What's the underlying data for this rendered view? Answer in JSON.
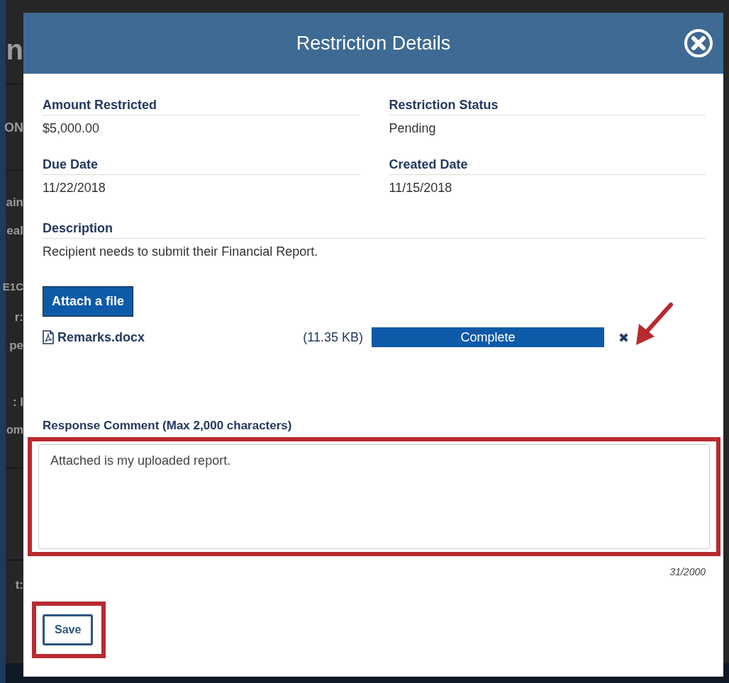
{
  "background": {
    "fragments": [
      "n",
      "ON",
      "ain",
      "eal",
      "E1C",
      "r:",
      "pe",
      ": I",
      "om",
      "t:"
    ]
  },
  "dialog": {
    "title": "Restriction Details",
    "fields": [
      {
        "label": "Amount Restricted",
        "value": "$5,000.00"
      },
      {
        "label": "Restriction Status",
        "value": "Pending"
      },
      {
        "label": "Due Date",
        "value": "11/22/2018"
      },
      {
        "label": "Created Date",
        "value": "11/15/2018"
      }
    ],
    "description": {
      "label": "Description",
      "value": "Recipient needs to submit their Financial Report."
    },
    "attach_button": "Attach a file",
    "files": [
      {
        "name": "Remarks.docx",
        "size": "(11.35 KB)",
        "status": "Complete",
        "level": 1,
        "remove": "✖"
      }
    ],
    "comment": {
      "label": "Response Comment (Max 2,000 characters)",
      "value": "Attached is my uploaded report.",
      "counter": "31/2000"
    },
    "save_button": "Save"
  }
}
